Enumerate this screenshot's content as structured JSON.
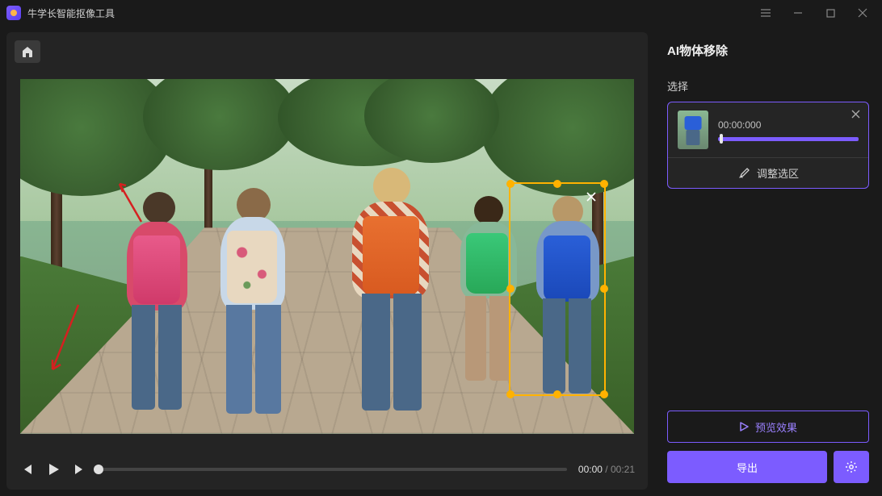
{
  "app": {
    "title": "牛学长智能抠像工具"
  },
  "player": {
    "current_time": "00:00",
    "total_time": "00:21"
  },
  "panel": {
    "title": "AI物体移除",
    "select_label": "选择",
    "selection": {
      "timestamp": "00:00:000"
    },
    "adjust_label": "调整选区",
    "preview_label": "预览效果",
    "export_label": "导出"
  },
  "colors": {
    "accent": "#7c5cff",
    "selection_border": "#ffb200"
  }
}
